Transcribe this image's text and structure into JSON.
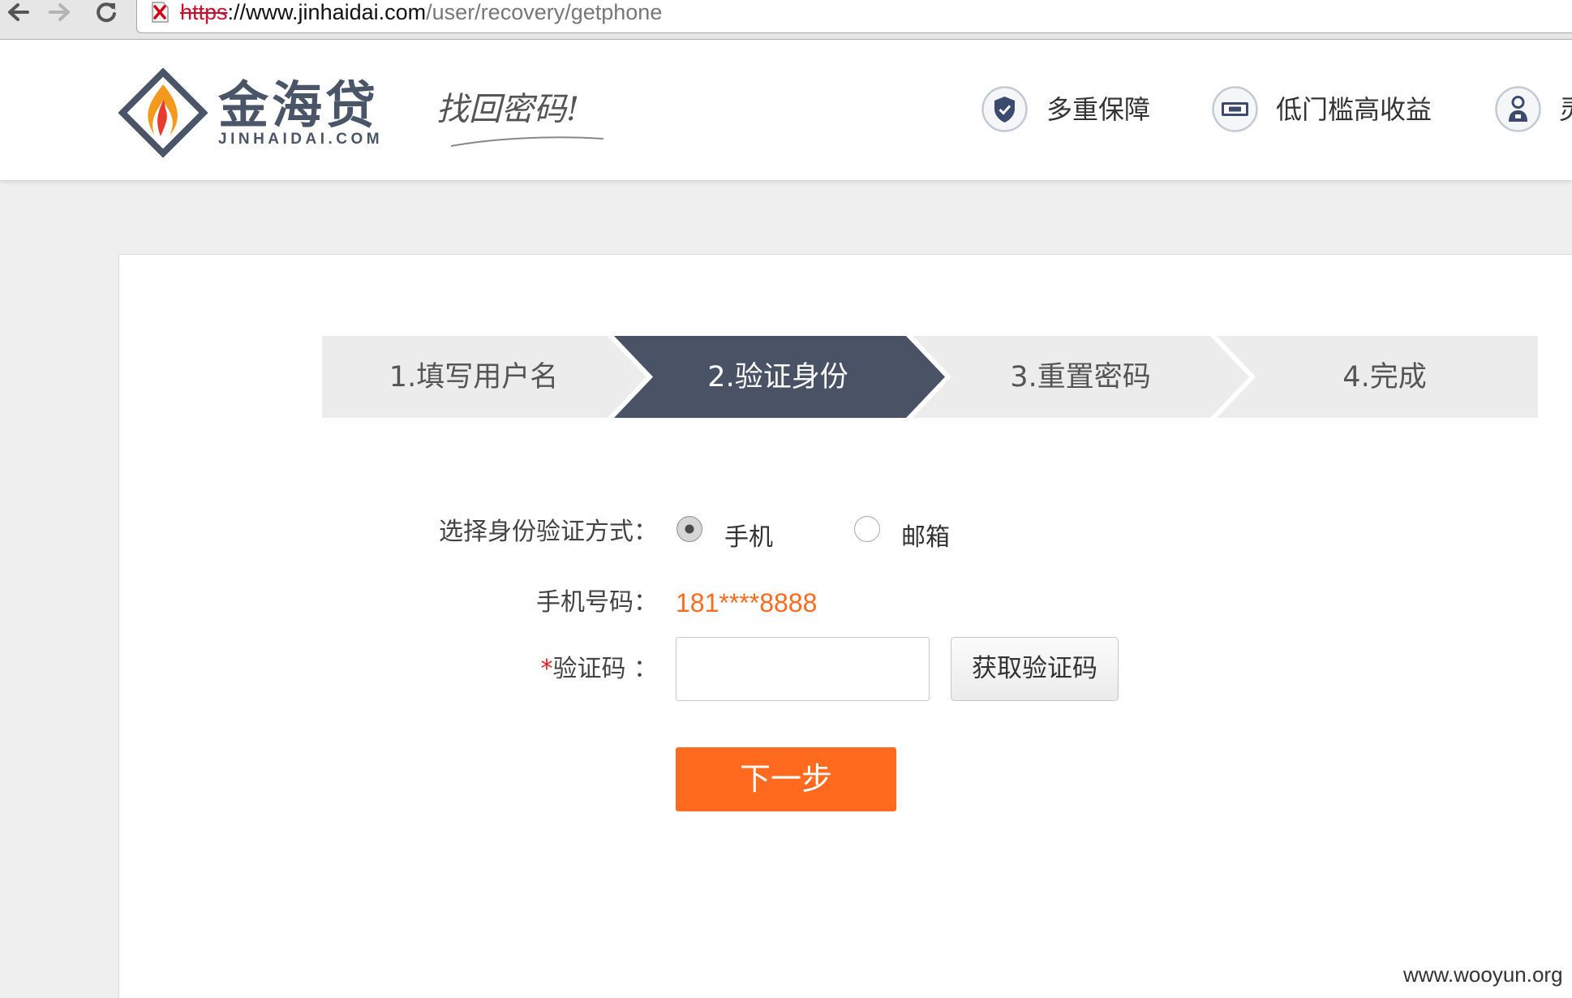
{
  "browser": {
    "url": {
      "scheme": "https",
      "host": "://www.jinhaidai.com",
      "path": "/user/recovery/getphone"
    },
    "security_icon": "page-error-icon"
  },
  "colors": {
    "accent": "#ff6a1f",
    "brand": "#4a5568",
    "step-active": "#4a5366",
    "step-inactive": "#ececec",
    "required": "#e02020",
    "url-error": "#c8102e"
  },
  "header": {
    "brand_name": "金海贷",
    "brand_domain": "JINHAIDAI.COM",
    "tagline": "找回密码!",
    "features": [
      {
        "icon": "shield-check-icon",
        "label": "多重保障"
      },
      {
        "icon": "banknote-icon",
        "label": "低门槛高收益"
      },
      {
        "icon": "user-icon",
        "label": "灵"
      }
    ]
  },
  "steps": {
    "active_index": 1,
    "items": [
      "1.填写用户名",
      "2.验证身份",
      "3.重置密码",
      "4.完成"
    ]
  },
  "form": {
    "verify_method": {
      "label": "选择身份验证方式：",
      "options": [
        {
          "label": "手机",
          "checked": true
        },
        {
          "label": "邮箱",
          "checked": false
        }
      ]
    },
    "phone": {
      "label": "手机号码：",
      "value": "181****8888"
    },
    "code": {
      "required_mark": "*",
      "label": "验证码 ：",
      "value": "",
      "get_code_button": "获取验证码"
    },
    "next_button": "下一步"
  },
  "watermark": "www.wooyun.org"
}
